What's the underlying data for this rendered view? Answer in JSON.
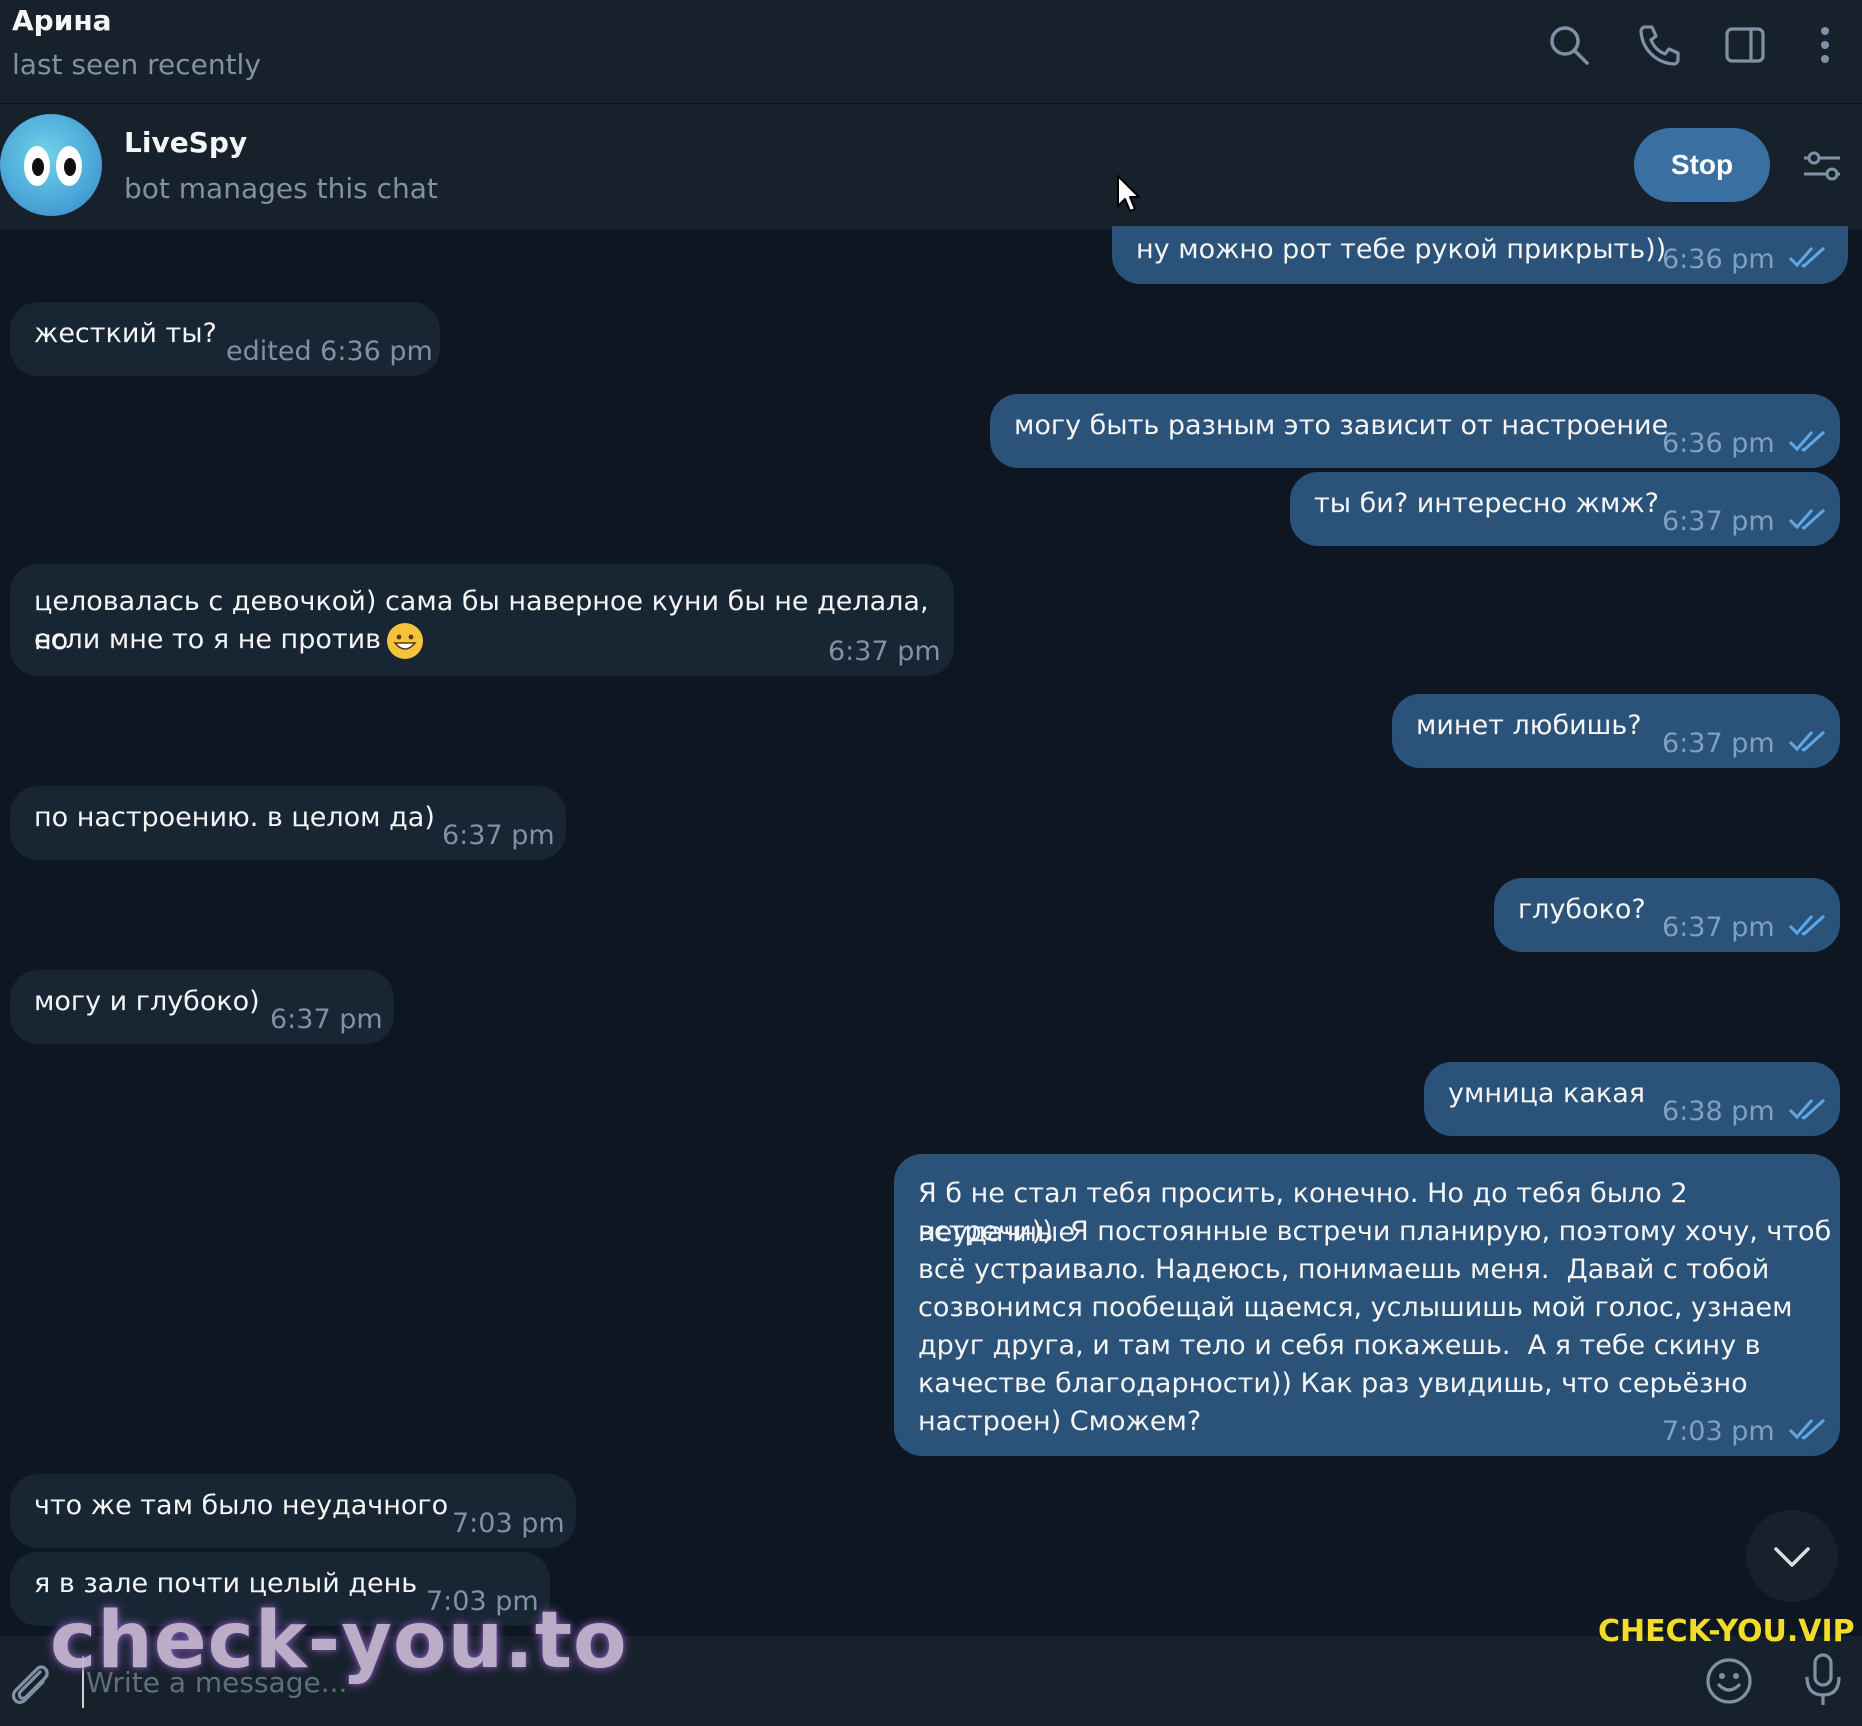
{
  "header": {
    "name": "Арина",
    "status": "last seen recently"
  },
  "bot_bar": {
    "name": "LiveSpy",
    "subtitle": "bot manages this chat",
    "stop_label": "Stop"
  },
  "messages": [
    {
      "dir": "out",
      "text": "ну можно рот тебе рукой прикрыть))",
      "time": "6:36 pm"
    },
    {
      "dir": "in",
      "text": "жесткий ты?",
      "time": "edited 6:36 pm"
    },
    {
      "dir": "out",
      "text": "могу быть разным это зависит от настроение",
      "time": "6:36 pm"
    },
    {
      "dir": "out",
      "text": "ты би? интересно жмж?",
      "time": "6:37 pm"
    },
    {
      "dir": "in",
      "text_line1": "целовалась с девочкой) сама бы наверное куни бы не делала, но",
      "text_line2": "если мне то я не против",
      "time": "6:37 pm"
    },
    {
      "dir": "out",
      "text": "минет любишь?",
      "time": "6:37 pm"
    },
    {
      "dir": "in",
      "text": "по настроению. в целом да)",
      "time": "6:37 pm"
    },
    {
      "dir": "out",
      "text": "глубоко?",
      "time": "6:37 pm"
    },
    {
      "dir": "in",
      "text": "могу и глубоко)",
      "time": "6:37 pm"
    },
    {
      "dir": "out",
      "text": "умница какая",
      "time": "6:38 pm"
    },
    {
      "dir": "out",
      "lines": [
        "Я б не стал тебя просить, конечно. Но до тебя было 2 неудачные",
        "встречи))  Я постоянные встречи планирую, поэтому хочу, чтоб",
        "всё устраивало. Надеюсь, понимаешь меня.  Давай с тобой",
        "созвонимся пообещай щаемся, услышишь мой голос, узнаем",
        "друг друга, и там тело и себя покажешь.  А я тебе скину в",
        "качестве благодарности)) Как раз увидишь, что серьёзно",
        "настроен) Сможем?"
      ],
      "time": "7:03 pm"
    },
    {
      "dir": "in",
      "text": "что же там было неудачного",
      "time": "7:03 pm"
    },
    {
      "dir": "in",
      "text": "я в зале почти целый день",
      "time": "7:03 pm"
    }
  ],
  "composer": {
    "placeholder": "Write a message..."
  },
  "watermarks": {
    "left": "check-you.to",
    "right": "CHECK-YOU.VIP"
  },
  "icons": {
    "header": [
      "search-icon",
      "phone-icon",
      "sidebar-toggle-icon",
      "more-vertical-icon"
    ],
    "bot_bar": [
      "bot-settings-icon"
    ],
    "composer": [
      "attach-icon",
      "emoji-icon",
      "microphone-icon"
    ],
    "scroll": "chevron-down-icon"
  },
  "colors": {
    "background": "#0e1621",
    "panel": "#17212b",
    "incoming_bubble": "#182533",
    "outgoing_bubble": "#2b5278",
    "accent_button": "#3a6fa2",
    "read_checks": "#5fa8e8"
  }
}
